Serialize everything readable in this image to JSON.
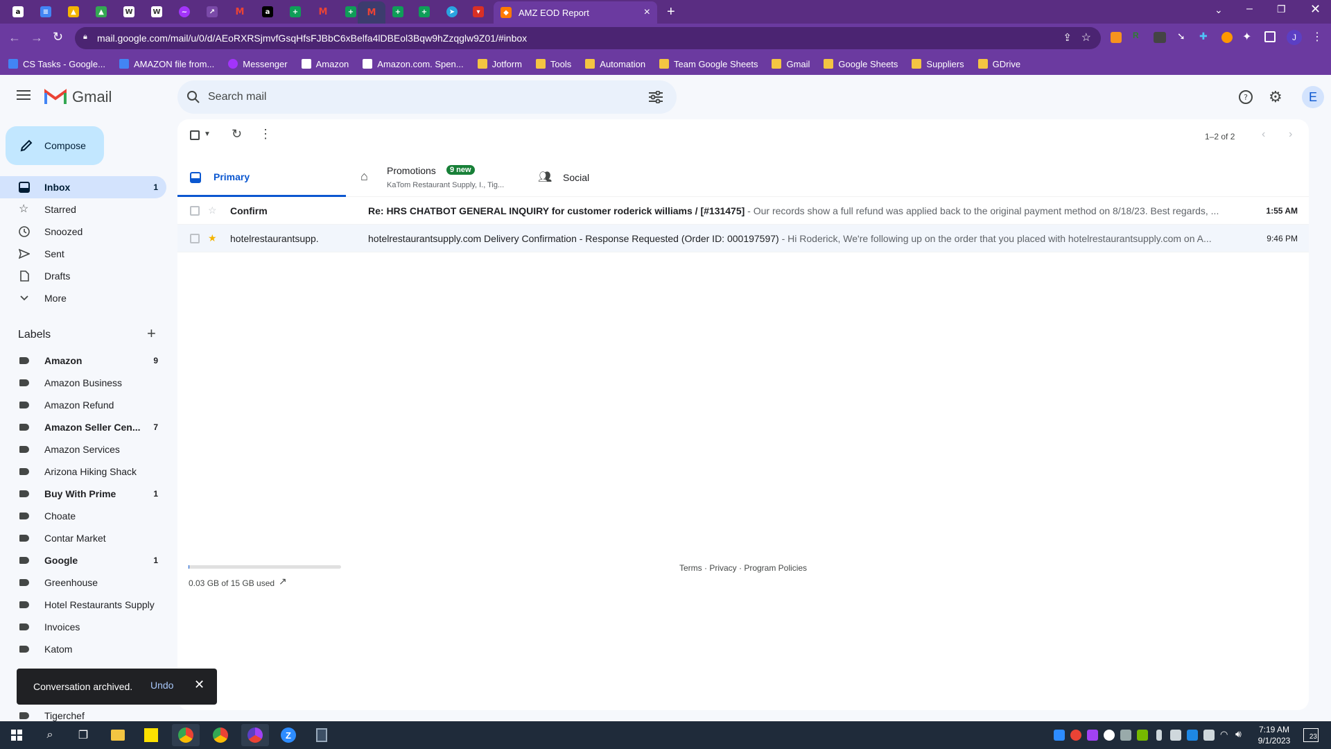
{
  "browser": {
    "active_tab_title": "AMZ EOD Report",
    "url": "mail.google.com/mail/u/0/d/AEoRXRSjmvfGsqHfsFJBbC6xBelfa4lDBEol3Bqw9hZzqglw9Z01/#inbox",
    "profile_initial": "J",
    "bookmarks": [
      {
        "label": "CS Tasks - Google...",
        "icon": "docs-icon"
      },
      {
        "label": "AMAZON file from...",
        "icon": "docs-icon"
      },
      {
        "label": "Messenger",
        "icon": "messenger-icon"
      },
      {
        "label": "Amazon",
        "icon": "amazon-icon"
      },
      {
        "label": "Amazon.com. Spen...",
        "icon": "amazon-icon"
      },
      {
        "label": "Jotform",
        "icon": "folder-icon"
      },
      {
        "label": "Tools",
        "icon": "folder-icon"
      },
      {
        "label": "Automation",
        "icon": "folder-icon"
      },
      {
        "label": "Team Google Sheets",
        "icon": "folder-icon"
      },
      {
        "label": "Gmail",
        "icon": "folder-icon"
      },
      {
        "label": "Google Sheets",
        "icon": "folder-icon"
      },
      {
        "label": "Suppliers",
        "icon": "folder-icon"
      },
      {
        "label": "GDrive",
        "icon": "folder-icon"
      }
    ]
  },
  "gmail": {
    "logo_text": "Gmail",
    "search_placeholder": "Search mail",
    "account_initial": "E",
    "compose_label": "Compose",
    "nav": [
      {
        "label": "Inbox",
        "count": "1",
        "icon": "inbox-icon"
      },
      {
        "label": "Starred",
        "count": "",
        "icon": "star-icon"
      },
      {
        "label": "Snoozed",
        "count": "",
        "icon": "clock-icon"
      },
      {
        "label": "Sent",
        "count": "",
        "icon": "send-icon"
      },
      {
        "label": "Drafts",
        "count": "",
        "icon": "draft-icon"
      },
      {
        "label": "More",
        "count": "",
        "icon": "chevron-down-icon"
      }
    ],
    "labels_heading": "Labels",
    "labels": [
      {
        "label": "Amazon",
        "count": "9",
        "bold": true
      },
      {
        "label": "Amazon Business",
        "count": "",
        "bold": false
      },
      {
        "label": "Amazon Refund",
        "count": "",
        "bold": false
      },
      {
        "label": "Amazon Seller Cen...",
        "count": "7",
        "bold": true
      },
      {
        "label": "Amazon Services",
        "count": "",
        "bold": false
      },
      {
        "label": "Arizona Hiking Shack",
        "count": "",
        "bold": false
      },
      {
        "label": "Buy With Prime",
        "count": "1",
        "bold": true
      },
      {
        "label": "Choate",
        "count": "",
        "bold": false
      },
      {
        "label": "Contar Market",
        "count": "",
        "bold": false
      },
      {
        "label": "Google",
        "count": "1",
        "bold": true
      },
      {
        "label": "Greenhouse",
        "count": "",
        "bold": false
      },
      {
        "label": "Hotel Restaurants Supply",
        "count": "",
        "bold": false
      },
      {
        "label": "Invoices",
        "count": "",
        "bold": false
      },
      {
        "label": "Katom",
        "count": "",
        "bold": false
      },
      {
        "label": "Tigerchef",
        "count": "",
        "bold": false
      }
    ],
    "pagination": "1–2 of 2",
    "tabs": {
      "primary": "Primary",
      "promotions": "Promotions",
      "promotions_badge": "9 new",
      "promotions_sub": "KaTom Restaurant Supply, I., Tig...",
      "social": "Social"
    },
    "emails": [
      {
        "sender": "Confirm",
        "subject": "Re: HRS CHATBOT GENERAL INQUIRY for customer roderick williams / [#131475]",
        "snippet": " - Our records show a full refund was applied back to the original payment method on 8/18/23. Best regards, ...",
        "time": "1:55 AM",
        "unread": true,
        "starred": false
      },
      {
        "sender": "hotelrestaurantsupp.",
        "subject": "hotelrestaurantsupply.com Delivery Confirmation - Response Requested (Order ID: 000197597)",
        "snippet": " - Hi Roderick, We're following up on the order that you placed with hotelrestaurantsupply.com on A...",
        "time": "9:46 PM",
        "unread": false,
        "starred": true
      }
    ],
    "storage": "0.03 GB of 15 GB used",
    "footer": "Terms · Privacy · Program Policies",
    "toast": {
      "message": "Conversation archived.",
      "action": "Undo"
    }
  },
  "taskbar": {
    "time": "7:19 AM",
    "date": "9/1/2023",
    "notification_count": "23"
  },
  "colors": {
    "chrome_purple": "#6b3aa0",
    "tab_strip": "#5a2d82",
    "inbox_active": "#d3e3fd",
    "compose_bg": "#c2e7ff",
    "primary_blue": "#0b57d0",
    "badge_green": "#188038",
    "star_yellow": "#f4b400"
  }
}
